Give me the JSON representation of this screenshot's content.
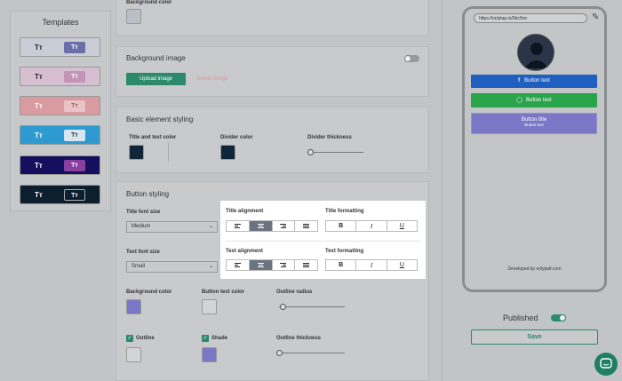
{
  "templates": {
    "title": "Templates",
    "items": [
      {
        "a": "Tт",
        "b": "Tт",
        "bg": "#c9cdd6",
        "fg": "#222",
        "chip_bg": "#6b6ea8",
        "chip_fg": "#fff"
      },
      {
        "a": "Tт",
        "b": "Tт",
        "bg": "#d7bfd2",
        "fg": "#222",
        "chip_bg": "#c495b9",
        "chip_fg": "#fff"
      },
      {
        "a": "Tт",
        "b": "Tт",
        "bg": "#d99aa0",
        "fg": "#fff",
        "chip_bg": "#e8c4c8",
        "chip_fg": "#b55"
      },
      {
        "a": "Tт",
        "b": "Tт",
        "bg": "#2d9ad1",
        "fg": "#fff",
        "chip_bg": "#d6e7f1",
        "chip_fg": "#333"
      },
      {
        "a": "Tт",
        "b": "Tт",
        "bg": "#14105e",
        "fg": "#fff",
        "chip_bg": "#8a3fa0",
        "chip_fg": "#fff"
      },
      {
        "a": "Tт",
        "b": "Tт",
        "bg": "#0d1e2f",
        "fg": "#fff",
        "chip_bg": "#0d1e2f",
        "chip_fg": "#fff"
      }
    ]
  },
  "bg_color": {
    "label": "Background color"
  },
  "bg_image": {
    "title": "Background image",
    "upload": "Upload image",
    "delete": "Delete image"
  },
  "basic": {
    "title": "Basic element styling",
    "title_text_color": "Title and text color",
    "divider_color": "Divider color",
    "divider_thickness": "Divider thickness"
  },
  "button_styling": {
    "title": "Button styling",
    "title_font_size": "Title font size",
    "title_font_value": "Medium",
    "text_font_size": "Text font size",
    "text_font_value": "Small",
    "title_alignment": "Title alignment",
    "title_formatting": "Title formatting",
    "text_alignment": "Text alignment",
    "text_formatting": "Text formatting",
    "bold": "B",
    "italic": "I",
    "underline": "U",
    "background_color": "Background color",
    "button_text_color": "Button text color",
    "outline_radius": "Outline radius",
    "outline": "Outline",
    "shade": "Shade",
    "outline_thickness": "Outline thickness"
  },
  "preview": {
    "url": "https://onlytap.io/0bc9rw",
    "button1": "Button text",
    "button2": "Button text",
    "button3_title": "Button title",
    "button3_text": "Button text",
    "footer": "Developed by onlypult.com"
  },
  "published": {
    "label": "Published"
  },
  "save": {
    "label": "Save"
  },
  "colors": {
    "accent": "#2a8a6a",
    "facebook": "#1f5fbf",
    "whatsapp": "#2aa44a",
    "purple": "#7a78c6"
  }
}
